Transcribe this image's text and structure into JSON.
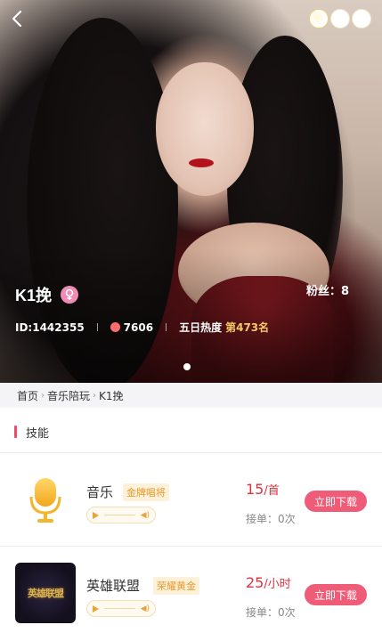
{
  "profile": {
    "name": "K1挽",
    "fans": "粉丝：8",
    "id": "ID:1442355",
    "heat": "7606",
    "five_day_heat_label": "五日热度",
    "rank": "第473名"
  },
  "breadcrumb": {
    "home": "首页",
    "category": "音乐陪玩",
    "current": "K1挽",
    "separator": "›"
  },
  "skills": {
    "header": "技能",
    "items": [
      {
        "name": "音乐",
        "badge": "金牌唱将",
        "price": "15",
        "unit": "/首",
        "orders": "接单：0次",
        "button": "立即下载",
        "icon": "microphone-icon"
      },
      {
        "name": "英雄联盟",
        "badge": "荣耀黄金",
        "price": "25",
        "unit": "/小时",
        "orders": "接单：0次",
        "button": "立即下载",
        "icon": "league-of-legends-logo",
        "logo_text": "英雄联盟"
      }
    ]
  },
  "colors": {
    "accent": "#ef5c78",
    "price": "#e0303c",
    "badge": "#e59a2c",
    "rank": "#f5c766"
  }
}
